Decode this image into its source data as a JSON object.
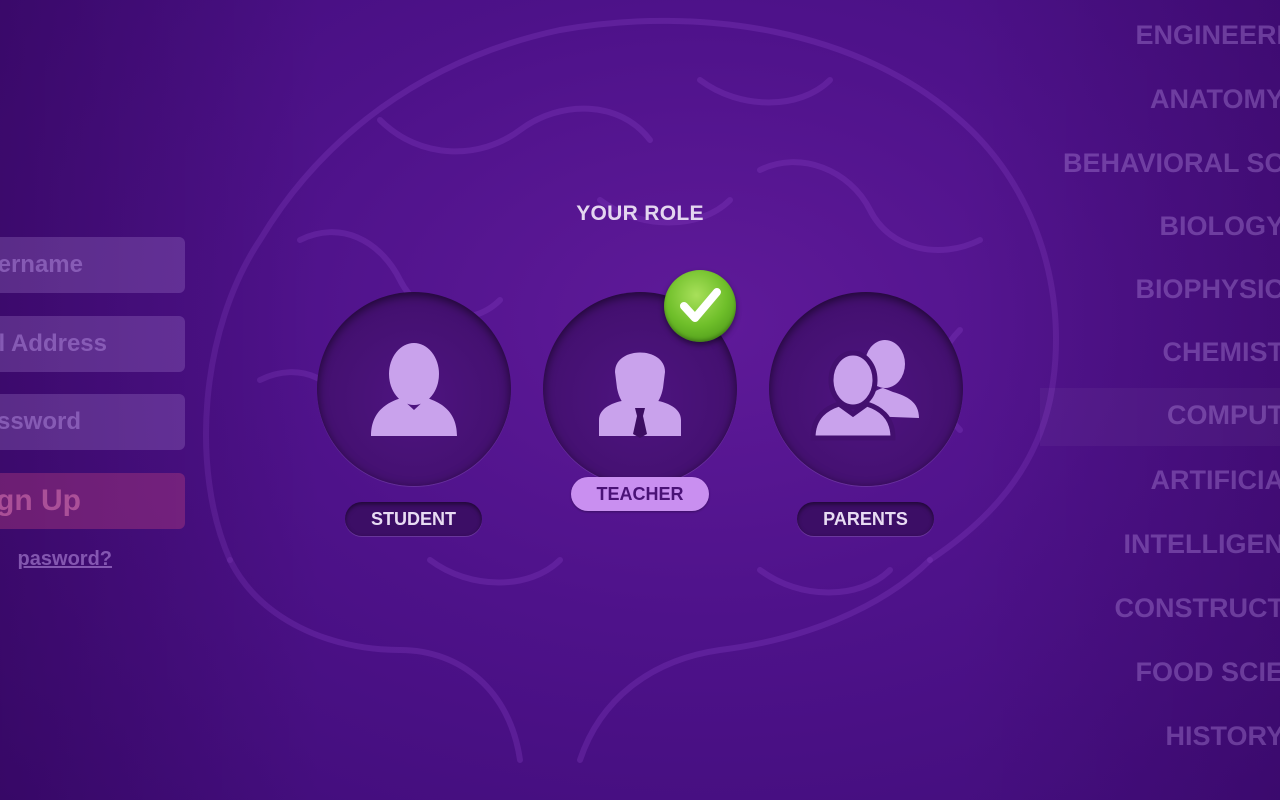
{
  "title": "YOUR ROLE",
  "roles": [
    {
      "id": "student",
      "label": "STUDENT",
      "selected": false
    },
    {
      "id": "teacher",
      "label": "TEACHER",
      "selected": true
    },
    {
      "id": "parents",
      "label": "PARENTS",
      "selected": false
    }
  ],
  "signup_form": {
    "username_placeholder": "ername",
    "email_placeholder": "l Address",
    "password_placeholder": "ssword",
    "signup_label": "gn Up",
    "forgot_label": "pasword?"
  },
  "subjects": [
    "ENGINEERI",
    "ANATOMY",
    "BEHAVIORAL SC",
    "BIOLOGY",
    "BIOPHYSIC",
    "CHEMIST",
    "COMPUT",
    "ARTIFICIA",
    "INTELLIGEN",
    "CONSTRUCT",
    "FOOD SCIE",
    "HISTORY"
  ],
  "colors": {
    "background": "#4e128a",
    "selected_label": "#c98ff0",
    "check": "#6fbf2a",
    "person": "#c9a2ec"
  },
  "icons": {
    "student": "person-icon",
    "teacher": "teacher-icon",
    "parents": "group-icon",
    "selected": "checkmark-icon"
  }
}
